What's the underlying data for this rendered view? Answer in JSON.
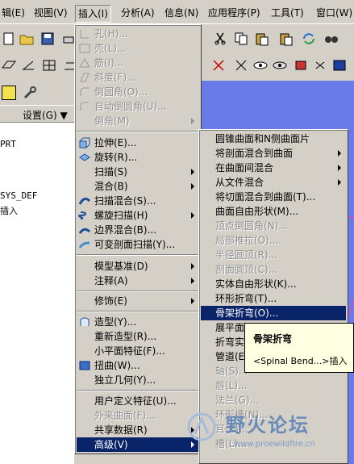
{
  "menubar": {
    "items": [
      {
        "label": "辑(E)"
      },
      {
        "label": "视图(V)"
      },
      {
        "label": "插入(I)"
      },
      {
        "label": "分析(A)"
      },
      {
        "label": "信息(N)"
      },
      {
        "label": "应用程序(P)"
      },
      {
        "label": "工具(T)"
      },
      {
        "label": "窗口(W)"
      }
    ]
  },
  "toolbar": {
    "settings_label": "设置(G) ▼"
  },
  "model_tree": {
    "lines": [
      "PRT",
      "SYS_DEF",
      "插入"
    ]
  },
  "insert_menu": {
    "items": [
      {
        "label": "孔(H)...",
        "disabled": true,
        "icon": "hole-icon"
      },
      {
        "label": "壳(L)...",
        "disabled": true,
        "icon": "shell-icon"
      },
      {
        "label": "筋(I)...",
        "disabled": true,
        "icon": "rib-icon"
      },
      {
        "label": "斜度(F)...",
        "disabled": true,
        "icon": "draft-icon"
      },
      {
        "label": "倒圆角(O)...",
        "disabled": true,
        "icon": "round-icon"
      },
      {
        "label": "自动倒圆角(U)...",
        "disabled": true,
        "icon": "auto-round-icon"
      },
      {
        "label": "倒角(M)",
        "disabled": true,
        "submenu": true
      },
      {
        "label": "拉伸(E)...",
        "icon": "extrude-icon"
      },
      {
        "label": "旋转(R)...",
        "icon": "revolve-icon"
      },
      {
        "label": "扫描(S)",
        "submenu": true
      },
      {
        "label": "混合(B)",
        "submenu": true
      },
      {
        "label": "扫描混合(S)...",
        "icon": "swept-blend-icon"
      },
      {
        "label": "螺旋扫描(H)",
        "icon": "helical-sweep-icon",
        "submenu": true
      },
      {
        "label": "边界混合(B)...",
        "icon": "boundary-blend-icon"
      },
      {
        "label": "可变剖面扫描(Y)...",
        "icon": "var-section-sweep-icon"
      },
      {
        "label": "模型基准(D)",
        "submenu": true
      },
      {
        "label": "注释(A)",
        "submenu": true
      },
      {
        "label": "修饰(E)",
        "submenu": true
      },
      {
        "label": "造型(Y)...",
        "icon": "style-icon"
      },
      {
        "label": "重新造型(R)..."
      },
      {
        "label": "小平面特征(F)..."
      },
      {
        "label": "扭曲(W)...",
        "icon": "warp-icon"
      },
      {
        "label": "独立几何(Y)..."
      },
      {
        "label": "用户定义特征(U)..."
      },
      {
        "label": "外来曲面(F)...",
        "disabled": true
      },
      {
        "label": "共享数据(R)",
        "submenu": true
      },
      {
        "label": "高级(V)",
        "submenu": true,
        "selected": true
      }
    ]
  },
  "advanced_menu": {
    "items": [
      {
        "label": "圆锥曲面和N侧曲面片"
      },
      {
        "label": "将剖面混合到曲面",
        "submenu": true
      },
      {
        "label": "在曲面间混合",
        "submenu": true
      },
      {
        "label": "从文件混合",
        "submenu": true
      },
      {
        "label": "将切面混合到曲面(T)..."
      },
      {
        "label": "曲面自由形状(M)..."
      },
      {
        "label": "顶点倒圆角(N)...",
        "disabled": true
      },
      {
        "label": "局部推拉(O)...",
        "disabled": true
      },
      {
        "label": "半径圆顶(R)...",
        "disabled": true
      },
      {
        "label": "剖面圆顶(C)...",
        "disabled": true
      },
      {
        "label": "实体自由形状(K)..."
      },
      {
        "label": "环形折弯(T)..."
      },
      {
        "label": "骨架折弯(O)...",
        "selected": true
      },
      {
        "label": "展平面组"
      },
      {
        "label": "折弯实"
      },
      {
        "label": "管道(E)"
      },
      {
        "label": "轴(S)...",
        "disabled": true
      },
      {
        "label": "唇(L)...",
        "disabled": true
      },
      {
        "label": "法兰(G)...",
        "disabled": true
      },
      {
        "label": "环形槽(N)...",
        "disabled": true
      },
      {
        "label": "耳(E)...",
        "disabled": true
      },
      {
        "label": "槽(L)...",
        "disabled": true
      }
    ]
  },
  "tooltip": {
    "title": "骨架折弯",
    "body": "<Spinal Bend...>插入"
  },
  "watermark": {
    "title": "野火论坛",
    "url": "www.proewildfire.cn"
  },
  "colors": {
    "graphics_bg": "#6a7be8",
    "highlight": "#0a246a",
    "menu_bg": "#d4d0c8"
  }
}
